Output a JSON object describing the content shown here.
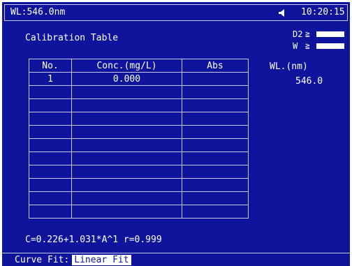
{
  "status": {
    "wavelength": "WL:546.0nm",
    "speaker_icon": "speaker-icon",
    "time": "10:20:15"
  },
  "title": "Calibration Table",
  "lamps": [
    {
      "name": "D2",
      "glyph": "≧"
    },
    {
      "name": "W",
      "glyph": "≧"
    }
  ],
  "wl_panel": {
    "label": "WL.(nm)",
    "value": "546.0"
  },
  "table": {
    "headers": [
      "No.",
      "Conc.(mg/L)",
      "Abs"
    ],
    "rows": [
      [
        "1",
        "0.000",
        ""
      ],
      [
        "",
        "",
        ""
      ],
      [
        "",
        "",
        ""
      ],
      [
        "",
        "",
        ""
      ],
      [
        "",
        "",
        ""
      ],
      [
        "",
        "",
        ""
      ],
      [
        "",
        "",
        ""
      ],
      [
        "",
        "",
        ""
      ],
      [
        "",
        "",
        ""
      ],
      [
        "",
        "",
        ""
      ],
      [
        "",
        "",
        ""
      ]
    ]
  },
  "equation": "C=0.226+1.031*A^1  r=0.999",
  "footer": {
    "curve_fit_label": "Curve Fit:",
    "curve_fit_value": "Linear Fit"
  },
  "colors": {
    "background": "#0f149c",
    "foreground": "#ffffff"
  }
}
